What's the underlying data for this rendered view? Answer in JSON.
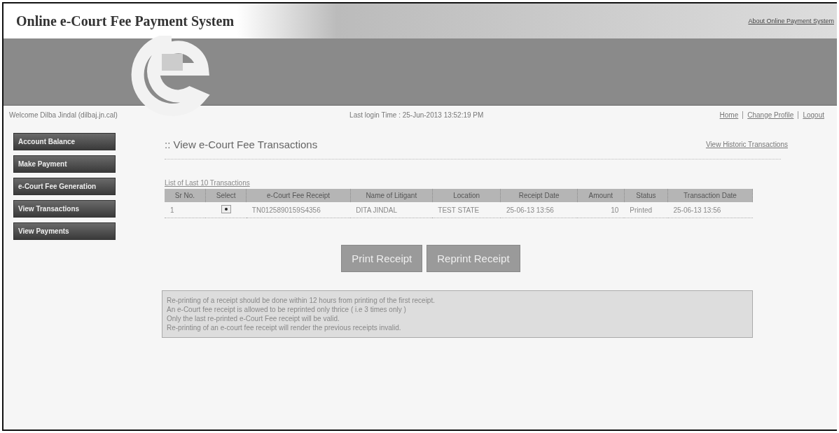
{
  "header": {
    "title": "Online e-Court Fee Payment System",
    "about_link": "About Online Payment System"
  },
  "user_bar": {
    "welcome": "Welcome Dilba Jindal (dilbaj.jn.cal)",
    "last_login": "Last login Time : 25-Jun-2013 13:52:19 PM",
    "links": [
      "Home",
      "Change Profile",
      "Logout"
    ]
  },
  "sidebar": {
    "items": [
      {
        "label": "Account Balance"
      },
      {
        "label": "Make Payment"
      },
      {
        "label": "e-Court Fee Generation"
      },
      {
        "label": "View Transactions"
      },
      {
        "label": "View Payments"
      }
    ]
  },
  "page_title": ":: View e-Court Fee Transactions",
  "historic_link": "View Historic Transactions",
  "table": {
    "caption": "List of Last 10 Transactions",
    "columns": [
      "Sr No.",
      "Select",
      "e-Court Fee Receipt",
      "Name of Litigant",
      "Location",
      "Receipt Date",
      "Amount",
      "Status",
      "Transaction Date"
    ],
    "rows": [
      {
        "sr": "1",
        "selected": true,
        "receipt": "TN0125890159S4356",
        "litigant": "DITA JINDAL",
        "location": "TEST STATE",
        "receipt_date": "25-06-13 13:56",
        "amount": "10",
        "status": "Printed",
        "transaction_date": "25-06-13 13:56"
      }
    ]
  },
  "buttons": [
    "Print Receipt",
    "Reprint Receipt"
  ],
  "notes": [
    "Re-printing of a receipt should be done within 12 hours from printing of the first receipt.",
    "An e-Court fee receipt is allowed to be reprinted only thrice ( i.e 3 times only )",
    "Only the last re-printed e-Court Fee receipt will be valid.",
    "Re-printing of an e-court fee receipt will render the previous receipts invalid."
  ]
}
